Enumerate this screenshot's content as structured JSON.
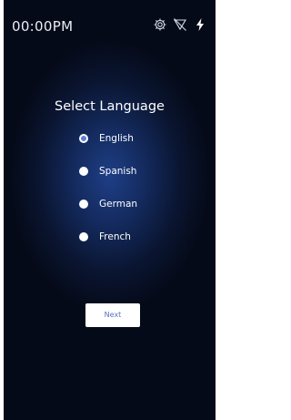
{
  "status_bar": {
    "time": "00:00PM",
    "icons": [
      "gear-icon",
      "no-signal-icon",
      "lightning-bolt-icon"
    ]
  },
  "language_select": {
    "title": "Select Language",
    "options": [
      {
        "label": "English",
        "selected": true
      },
      {
        "label": "Spanish",
        "selected": false
      },
      {
        "label": "German",
        "selected": false
      },
      {
        "label": "French",
        "selected": false
      }
    ],
    "next_label": "Next"
  },
  "colors": {
    "background_center": "#1e3e86",
    "background_edge": "#050a18",
    "radio_selected": "#5f7fd6",
    "button_text": "#5a73b8"
  }
}
